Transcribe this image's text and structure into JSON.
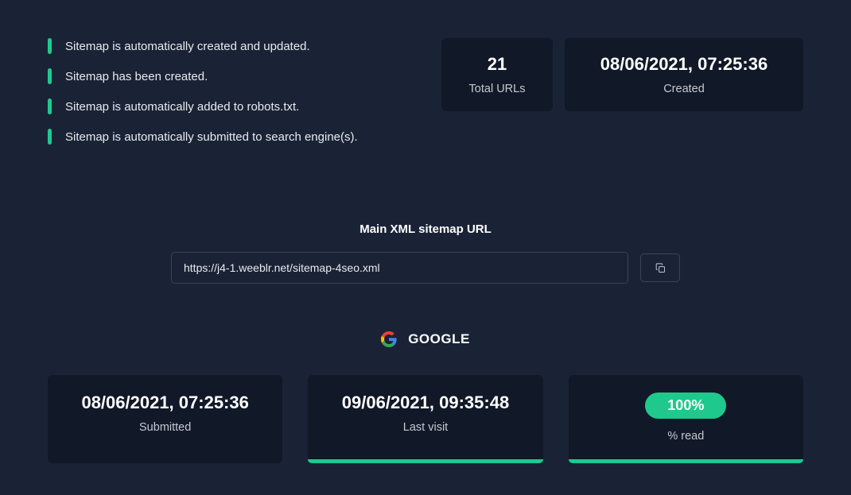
{
  "status": {
    "items": [
      "Sitemap is automatically created and updated.",
      "Sitemap has been created.",
      "Sitemap is automatically added to robots.txt.",
      "Sitemap is automatically submitted to search engine(s)."
    ]
  },
  "stats": {
    "total_urls": {
      "value": "21",
      "label": "Total URLs"
    },
    "created": {
      "value": "08/06/2021, 07:25:36",
      "label": "Created"
    }
  },
  "url_section": {
    "label": "Main XML sitemap URL",
    "value": "https://j4-1.weeblr.net/sitemap-4seo.xml"
  },
  "google": {
    "title": "GOOGLE",
    "submitted": {
      "value": "08/06/2021, 07:25:36",
      "label": "Submitted"
    },
    "last_visit": {
      "value": "09/06/2021, 09:35:48",
      "label": "Last visit"
    },
    "percent_read": {
      "value": "100%",
      "label": "% read"
    }
  }
}
